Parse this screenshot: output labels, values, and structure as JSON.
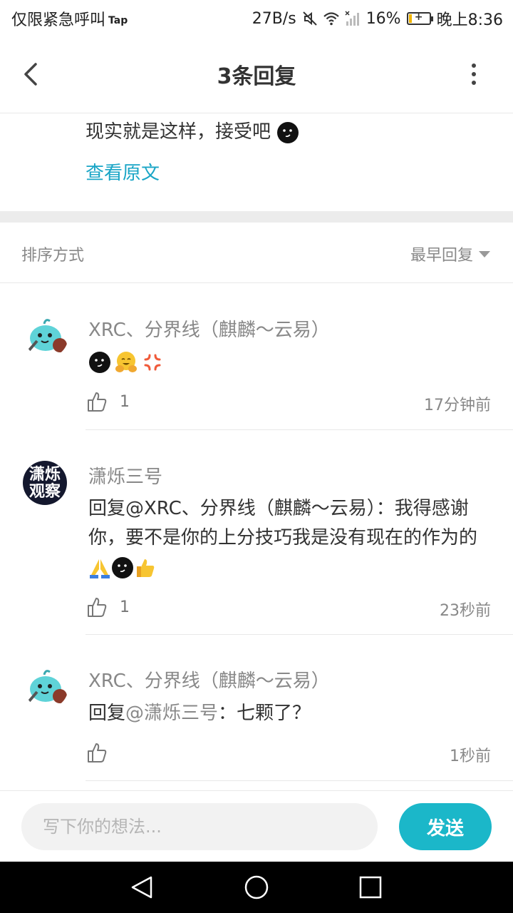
{
  "status_bar": {
    "carrier_text": "仅限紧急呼叫",
    "tap_badge": "Tap",
    "net_speed": "27B/s",
    "battery": "16%",
    "battery_level": 0.16,
    "time": "晚上8:36",
    "icons": [
      "mute-icon",
      "wifi-icon",
      "signal-icon",
      "battery-icon"
    ]
  },
  "header": {
    "title": "3条回复"
  },
  "original": {
    "text": "现实就是这样，接受吧",
    "view_original": "查看原文"
  },
  "sort": {
    "label": "排序方式",
    "selected": "最早回复"
  },
  "comments": [
    {
      "author": "XRC、分界线（麒麟～云易）",
      "text": "",
      "emojis": [
        "smirk-face-emoji",
        "hugging-face-emoji",
        "anger-symbol-emoji"
      ],
      "likes": "1",
      "time": "17分钟前"
    },
    {
      "author": "潇烁三号",
      "avatar_text": [
        "潇烁",
        "观察"
      ],
      "text": "回复@XRC、分界线（麒麟～云易）：我得感谢你，要不是你的上分技巧我是没有现在的作为的",
      "emojis": [
        "folded-hands-emoji",
        "smirk-face-emoji",
        "thumbs-up-emoji"
      ],
      "likes": "1",
      "time": "23秒前"
    },
    {
      "author": "XRC、分界线（麒麟～云易）",
      "text_prefix": "回复",
      "mention": "@潇烁三号",
      "text_suffix": "：七颗了？",
      "likes": "",
      "time": "1秒前"
    }
  ],
  "input": {
    "placeholder": "写下你的想法...",
    "send_label": "发送"
  },
  "colors": {
    "accent": "#19a5c6",
    "send_button": "#1bb7c9",
    "divider": "#ececec"
  }
}
